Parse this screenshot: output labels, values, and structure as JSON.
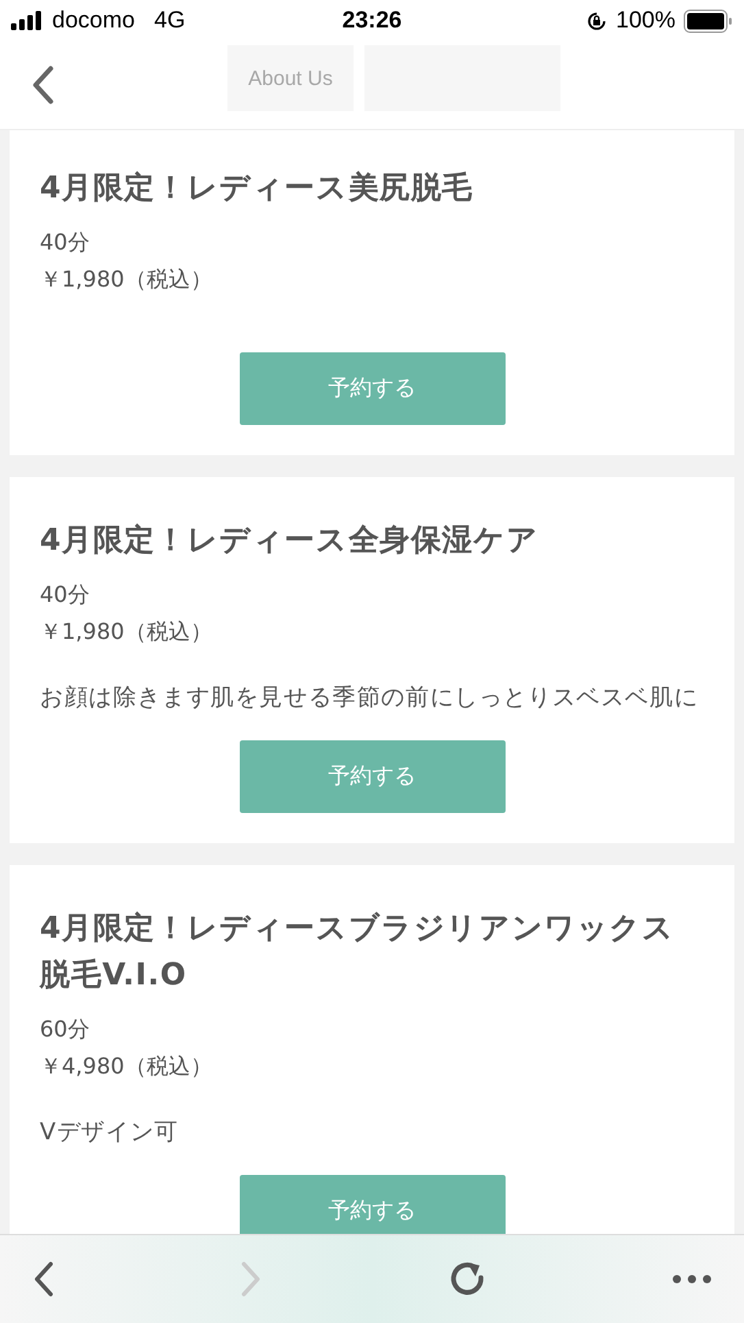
{
  "status_bar": {
    "carrier": "docomo",
    "network": "4G",
    "time": "23:26",
    "battery": "100%"
  },
  "header": {
    "tabs": [
      {
        "label": "About Us"
      }
    ]
  },
  "menu_items": [
    {
      "title": "4月限定！レディース美尻脱毛",
      "duration": "40分",
      "price": "￥1,980（税込）",
      "button": "予約する"
    },
    {
      "title": "4月限定！レディース全身保湿ケア",
      "duration": "40分",
      "price": "￥1,980（税込）",
      "description": "お顔は除きます肌を見せる季節の前にしっとりスベスベ肌に",
      "button": "予約する"
    },
    {
      "title": "4月限定！レディースブラジリアンワックス脱毛V.I.O",
      "duration": "60分",
      "price": "￥4,980（税込）",
      "description": "Vデザイン可",
      "button": "予約する"
    }
  ],
  "toolbar": [
    {
      "kind": "back",
      "disabled": false
    },
    {
      "kind": "forward",
      "disabled": true
    },
    {
      "kind": "reload",
      "disabled": false
    },
    {
      "kind": "more",
      "disabled": false
    }
  ]
}
